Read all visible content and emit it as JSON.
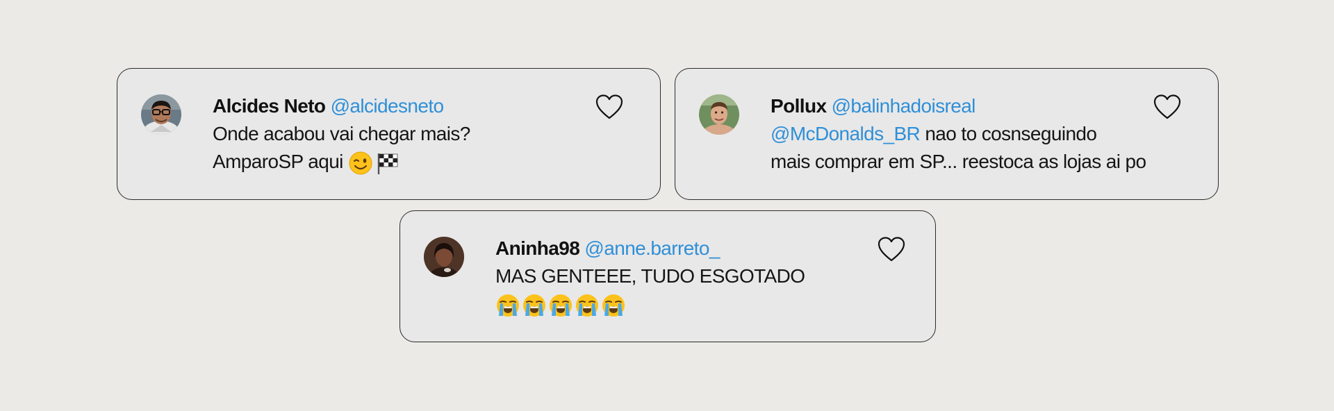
{
  "colors": {
    "background": "#eceae7",
    "card": "#e8e8e8",
    "handle": "#2f8fd8",
    "text": "#151515"
  },
  "tweets": [
    {
      "name": "Alcides Neto",
      "handle": "@alcidesneto",
      "lines": [
        "Onde acabou vai chegar mais?",
        "AmparoSP aqui"
      ],
      "emojis": [
        "winking-face-emoji",
        "checkered-flag-emoji"
      ],
      "icon": "heart-icon"
    },
    {
      "name": "Pollux",
      "handle": "@balinhadoisreal",
      "mention": "@McDonalds_BR",
      "lines": [
        " nao to cosnseguindo",
        "mais comprar em SP... reestoca as lojas ai po"
      ],
      "icon": "heart-icon"
    },
    {
      "name": "Aninha98",
      "handle": "@anne.barreto_",
      "lines": [
        "MAS GENTEEE, TUDO ESGOTADO"
      ],
      "emojis": [
        "loudly-crying-face-emoji",
        "loudly-crying-face-emoji",
        "loudly-crying-face-emoji",
        "loudly-crying-face-emoji",
        "loudly-crying-face-emoji"
      ],
      "icon": "heart-icon"
    }
  ]
}
